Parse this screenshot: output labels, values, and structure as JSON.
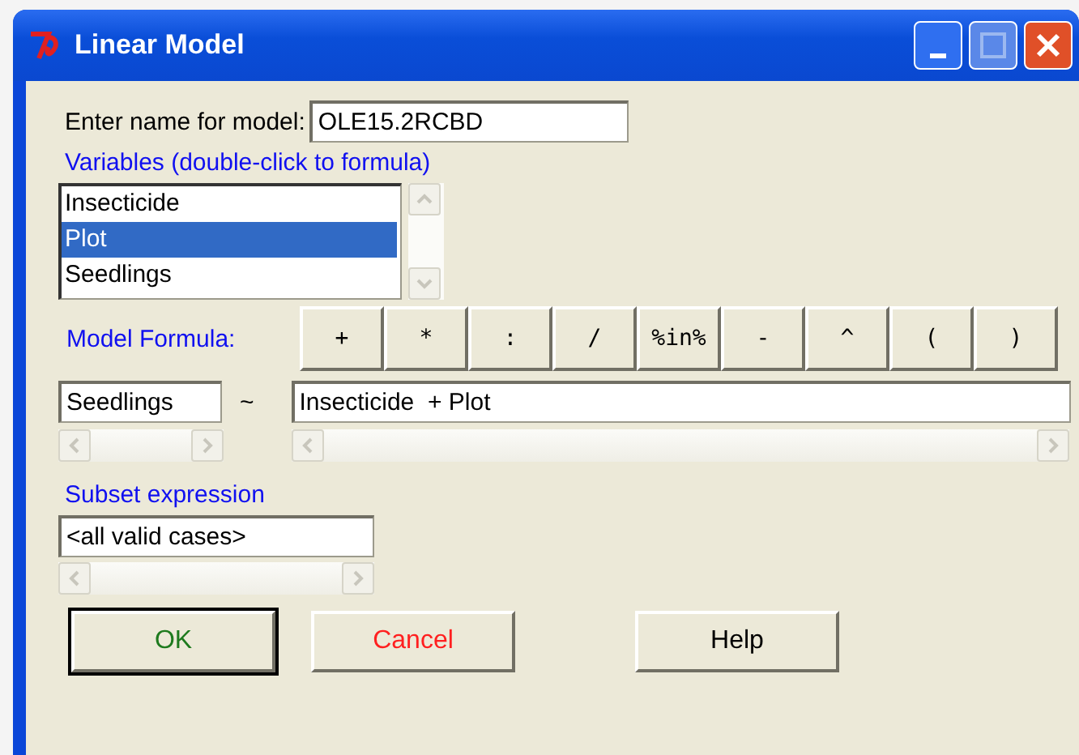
{
  "window": {
    "title": "Linear Model"
  },
  "model_name": {
    "label": "Enter name for model:",
    "value": "OLE15.2RCBD"
  },
  "variables": {
    "label": "Variables (double-click to formula)",
    "items": [
      {
        "label": "Insecticide",
        "selected": false
      },
      {
        "label": "Plot",
        "selected": true
      },
      {
        "label": "Seedlings",
        "selected": false
      }
    ]
  },
  "formula": {
    "label": "Model Formula:",
    "operators": [
      "+",
      "*",
      ":",
      "/",
      "%in%",
      "-",
      "^",
      "(",
      ")"
    ],
    "lhs": "Seedlings",
    "tilde": "~",
    "rhs": "Insecticide  + Plot"
  },
  "subset": {
    "label": "Subset expression",
    "value": "<all valid cases>"
  },
  "buttons": [
    {
      "label": "OK",
      "color": "#1e7a1e",
      "default": true
    },
    {
      "label": "Cancel",
      "color": "#ff2020",
      "default": false
    },
    {
      "label": "Help",
      "color": "#000000",
      "default": false
    }
  ]
}
